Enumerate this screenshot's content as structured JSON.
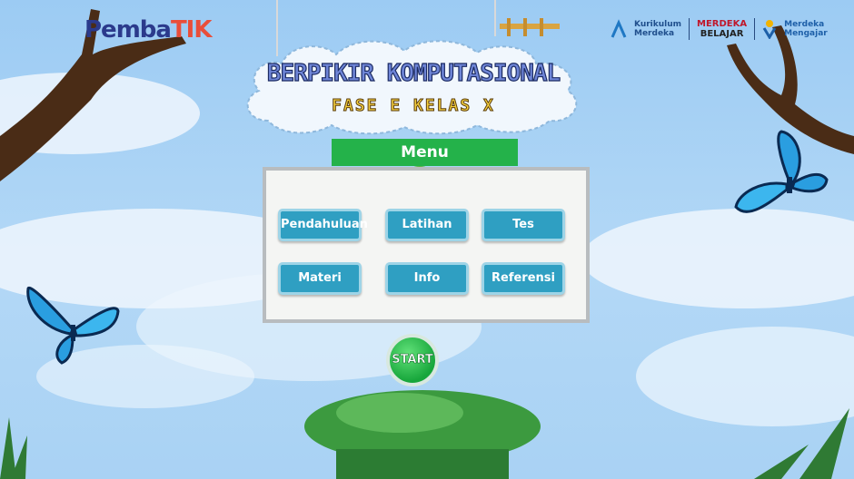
{
  "header": {
    "logo_left": "Pemba",
    "logo_right": "TIK",
    "partner_1_line1": "Kurikulum",
    "partner_1_line2": "Merdeka",
    "partner_2_line1": "MERDEKA",
    "partner_2_line2": "BELAJAR",
    "partner_3_line1": "Merdeka",
    "partner_3_line2": "Mengajar"
  },
  "title": {
    "main": "BERPIKIR KOMPUTASIONAL",
    "sub": "FASE E KELAS X"
  },
  "menu": {
    "header": "Menu",
    "buttons": [
      "Pendahuluan",
      "Latihan",
      "Tes",
      "Materi",
      "Info",
      "Referensi"
    ]
  },
  "start_label": "START",
  "colors": {
    "sky": "#9ccbf3",
    "menu_header": "#24b24a",
    "menu_button": "#2f9fc2",
    "start_button": "#17a63b"
  }
}
